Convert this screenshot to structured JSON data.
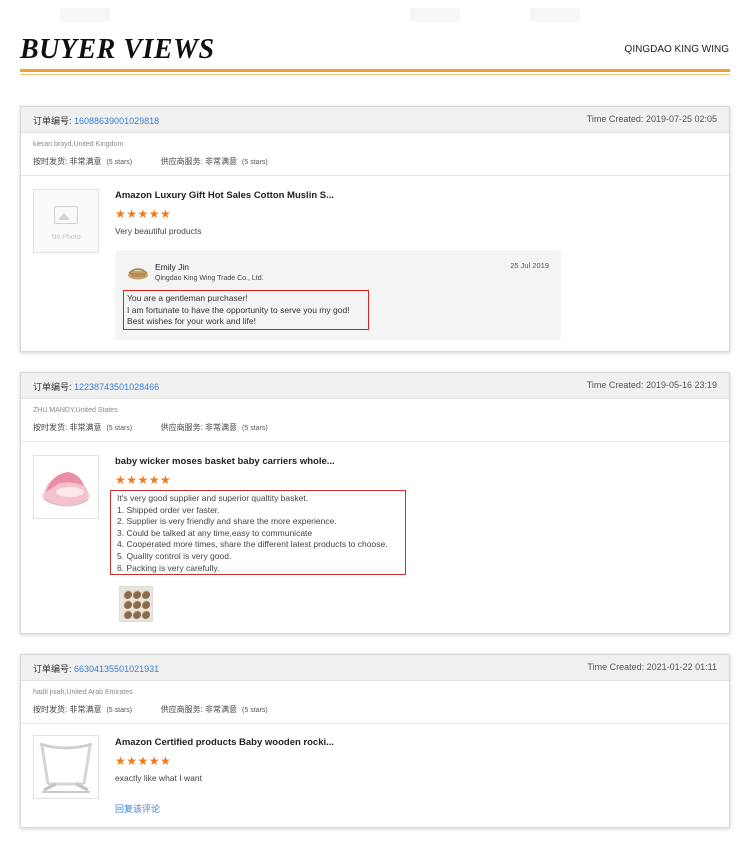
{
  "header": {
    "title": "BUYER VIEWS",
    "company": "QINGDAO KING WING",
    "accent_color": "#f0a030"
  },
  "labels": {
    "order_prefix": "订单编号: ",
    "time_prefix": "Time Created: ",
    "delivery_label": "按时发货: ",
    "service_label": "供应商服务: "
  },
  "reviews": [
    {
      "order_number": "16088639001029818",
      "time_created": "2019-07-25 02:05",
      "buyer": "kieran broyd,United Kingdom",
      "delivery_rating": "非常满意",
      "delivery_stars": "(5 stars)",
      "service_rating": "非常满意",
      "service_stars": "(5 stars)",
      "product_title": "Amazon Luxury Gift Hot Sales Cotton Muslin S...",
      "stars": "★★★★★",
      "rating_value": 5,
      "comment": "Very beautiful products",
      "thumb_icon": "no-photo-icon",
      "thumb_text": "No Photo",
      "reply": {
        "name": "Emily Jin",
        "company": "Qingdao King Wing Trade Co., Ltd.",
        "date": "25 Jul 2019",
        "avatar_icon": "basket-avatar-icon",
        "lines": [
          "You are a gentleman purchaser!",
          "I am fortunate to have the opportunity to serve you my god!",
          "Best wishes for your work and life!"
        ]
      }
    },
    {
      "order_number": "12238743501028466",
      "time_created": "2019-05-16 23:19",
      "buyer": "ZHU MANDY,United States",
      "delivery_rating": "非常满意",
      "delivery_stars": "(5 stars)",
      "service_rating": "非常满意",
      "service_stars": "(5 stars)",
      "product_title": "baby wicker moses basket baby carriers whole...",
      "stars": "★★★★★",
      "rating_value": 5,
      "thumb_icon": "pink-bassinet-image",
      "feedback_lines": [
        "It's  very good supplier and superior qualtity basket.",
        "1. Shipped order ver faster.",
        "2. Supplier is very friendly and share the more experience.",
        "3. Could be talked at any time,easy to communicate",
        "4. Cooperated more times, share the different latest products to choose.",
        "5. Quality control is very good.",
        "6. Packing is very carefully."
      ],
      "attachment_icon": "packed-goods-photo"
    },
    {
      "order_number": "66304135501021931",
      "time_created": "2021-01-22 01:11",
      "buyer": "hadil jniah,United Arab Emirates",
      "delivery_rating": "非常满意",
      "delivery_stars": "(5 stars)",
      "service_rating": "非常满意",
      "service_stars": "(5 stars)",
      "product_title": "Amazon Certified products Baby wooden rocki...",
      "stars": "★★★★★",
      "rating_value": 5,
      "comment": "exactly like what I want",
      "thumb_icon": "wooden-stand-image",
      "reply_link": "回复该评论"
    }
  ]
}
